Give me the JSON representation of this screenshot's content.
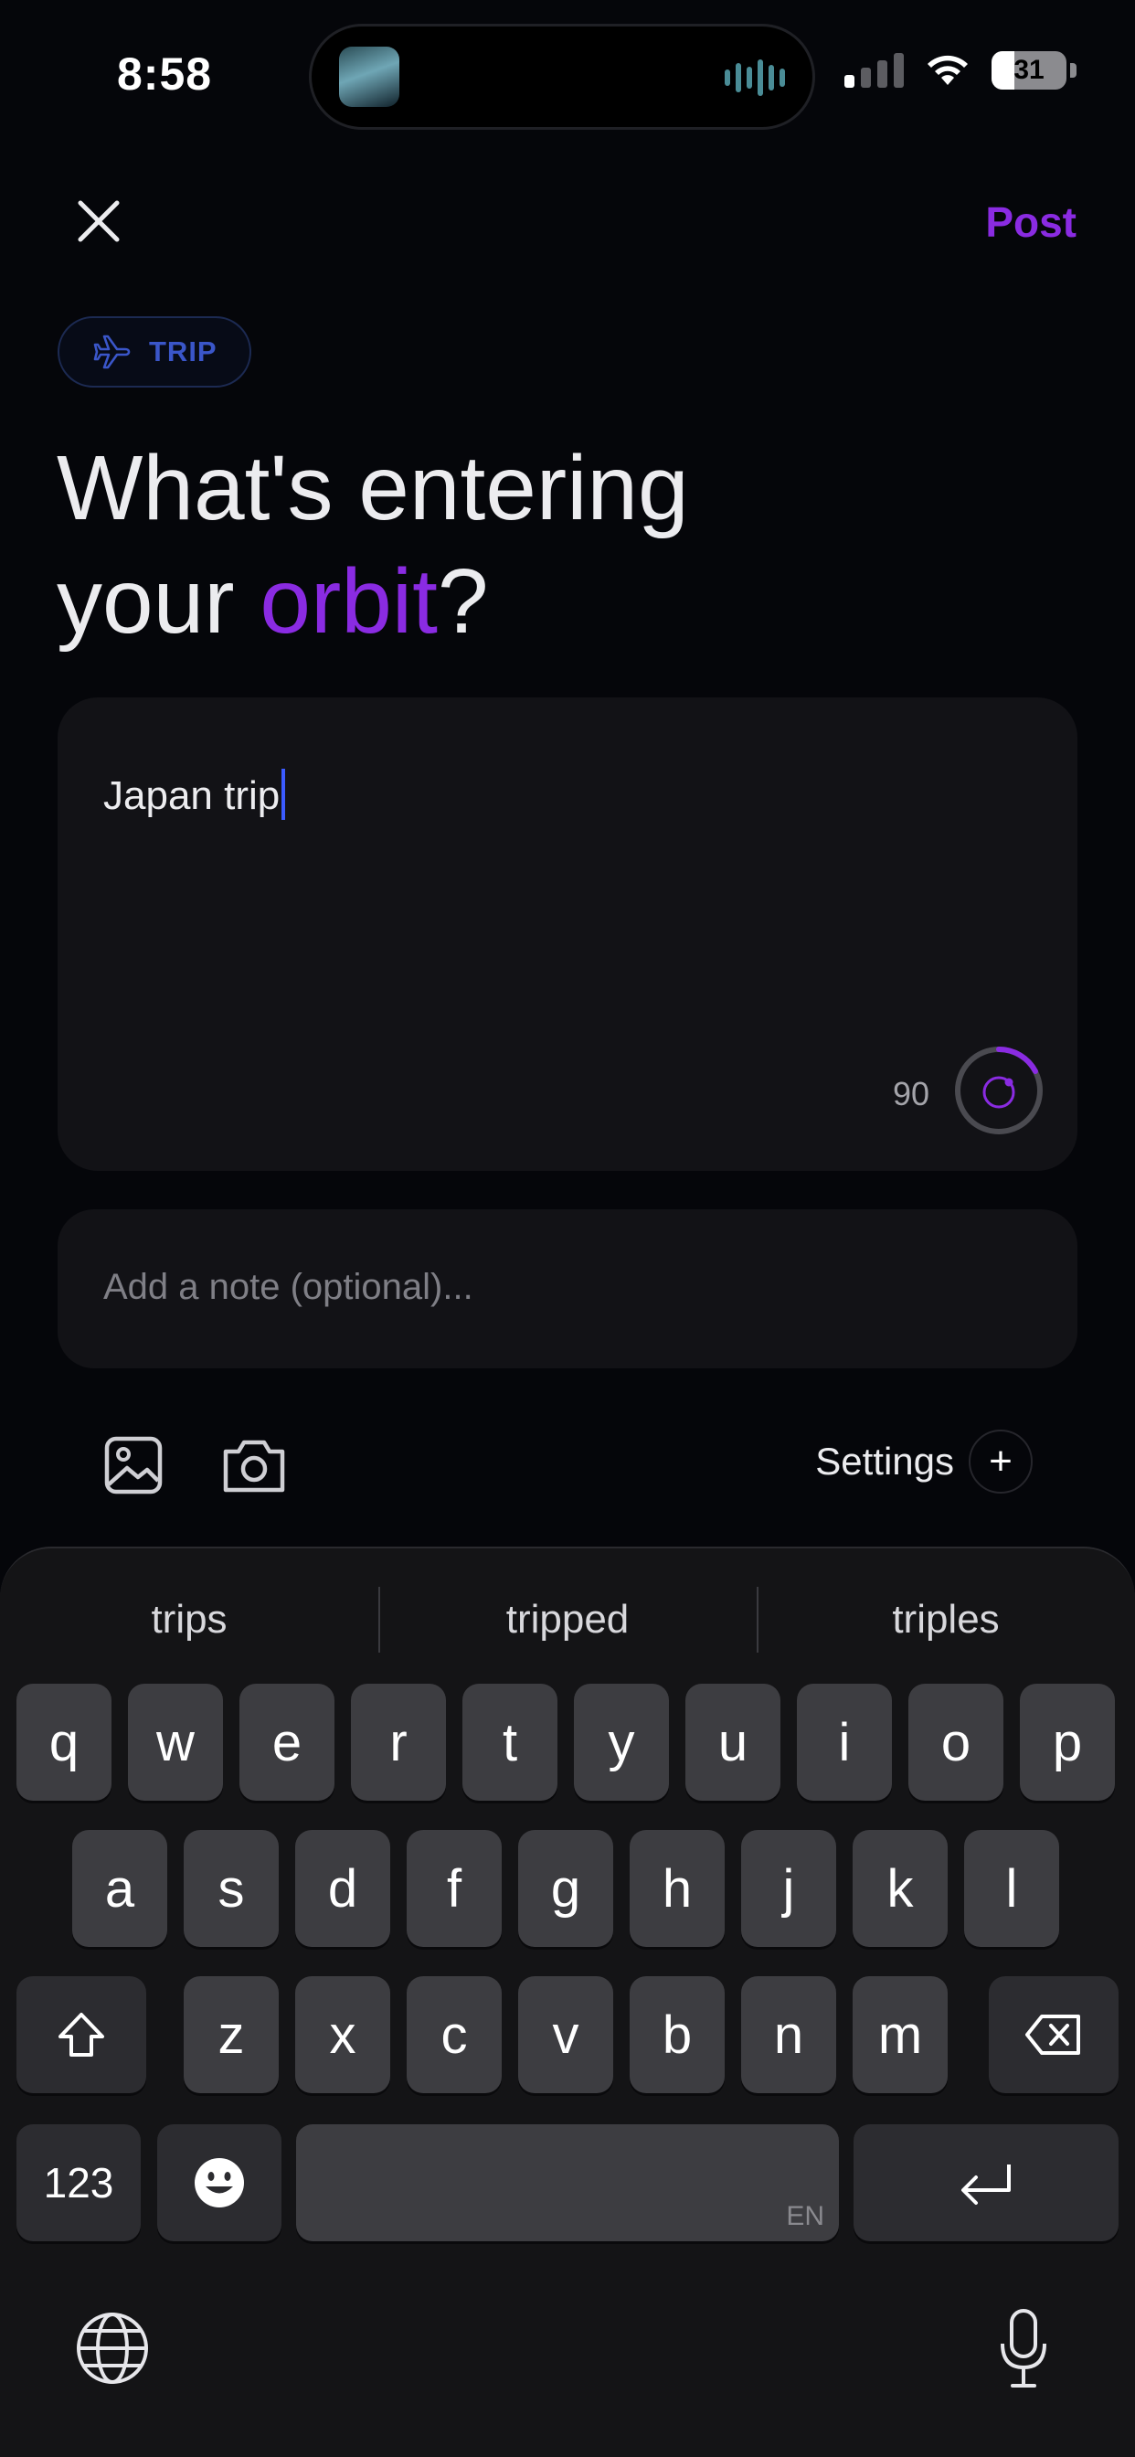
{
  "status_bar": {
    "time": "8:58",
    "battery": "31",
    "battery_level": 0.31
  },
  "header": {
    "close_icon": "close-icon",
    "post_label": "Post"
  },
  "tag": {
    "icon": "airplane-icon",
    "label": "TRIP"
  },
  "headline": {
    "line1": "What's entering",
    "line2_prefix": "your ",
    "line2_accent": "orbit",
    "line2_suffix": "?"
  },
  "composer": {
    "value": "Japan trip",
    "char_count": "90"
  },
  "note": {
    "placeholder": "Add a note (optional)..."
  },
  "toolbar": {
    "photo_icon": "photo-icon",
    "camera_icon": "camera-icon",
    "settings_label": "Settings",
    "settings_plus": "+"
  },
  "keyboard": {
    "suggestions": [
      "trips",
      "tripped",
      "triples"
    ],
    "row1": [
      "q",
      "w",
      "e",
      "r",
      "t",
      "y",
      "u",
      "i",
      "o",
      "p"
    ],
    "row2": [
      "a",
      "s",
      "d",
      "f",
      "g",
      "h",
      "j",
      "k",
      "l"
    ],
    "row3": [
      "z",
      "x",
      "c",
      "v",
      "b",
      "n",
      "m"
    ],
    "numbers_label": "123",
    "space_language": "EN"
  },
  "colors": {
    "accent": "#8a2be2",
    "tag_blue": "#3a56c9",
    "caret": "#3b5bff"
  }
}
